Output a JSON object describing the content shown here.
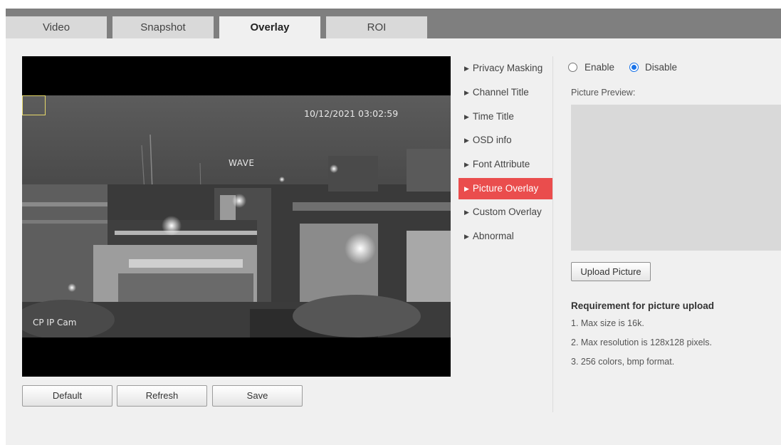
{
  "tabs": [
    {
      "label": "Video"
    },
    {
      "label": "Snapshot"
    },
    {
      "label": "Overlay",
      "active": true
    },
    {
      "label": "ROI"
    }
  ],
  "video": {
    "timestamp": "10/12/2021 03:02:59",
    "channel_title": "CP IP Cam",
    "building_sign": "WAVE"
  },
  "buttons": {
    "default": "Default",
    "refresh": "Refresh",
    "save": "Save"
  },
  "menu": {
    "items": [
      {
        "label": "Privacy Masking"
      },
      {
        "label": "Channel Title"
      },
      {
        "label": "Time Title"
      },
      {
        "label": "OSD info"
      },
      {
        "label": "Font Attribute"
      },
      {
        "label": "Picture Overlay",
        "active": true
      },
      {
        "label": "Custom Overlay"
      },
      {
        "label": "Abnormal"
      }
    ],
    "arrow_icon": "▶"
  },
  "picture_overlay": {
    "enable_label": "Enable",
    "disable_label": "Disable",
    "selected": "Disable",
    "preview_label": "Picture Preview:",
    "upload_button": "Upload Picture",
    "requirement_title": "Requirement for picture upload",
    "requirements": [
      "1. Max size is 16k.",
      "2. Max resolution is 128x128 pixels.",
      "3. 256 colors, bmp format."
    ]
  },
  "colors": {
    "accent": "#ea4d4d",
    "radio": "#1a73e8",
    "tabbar": "#7f7f7f"
  }
}
